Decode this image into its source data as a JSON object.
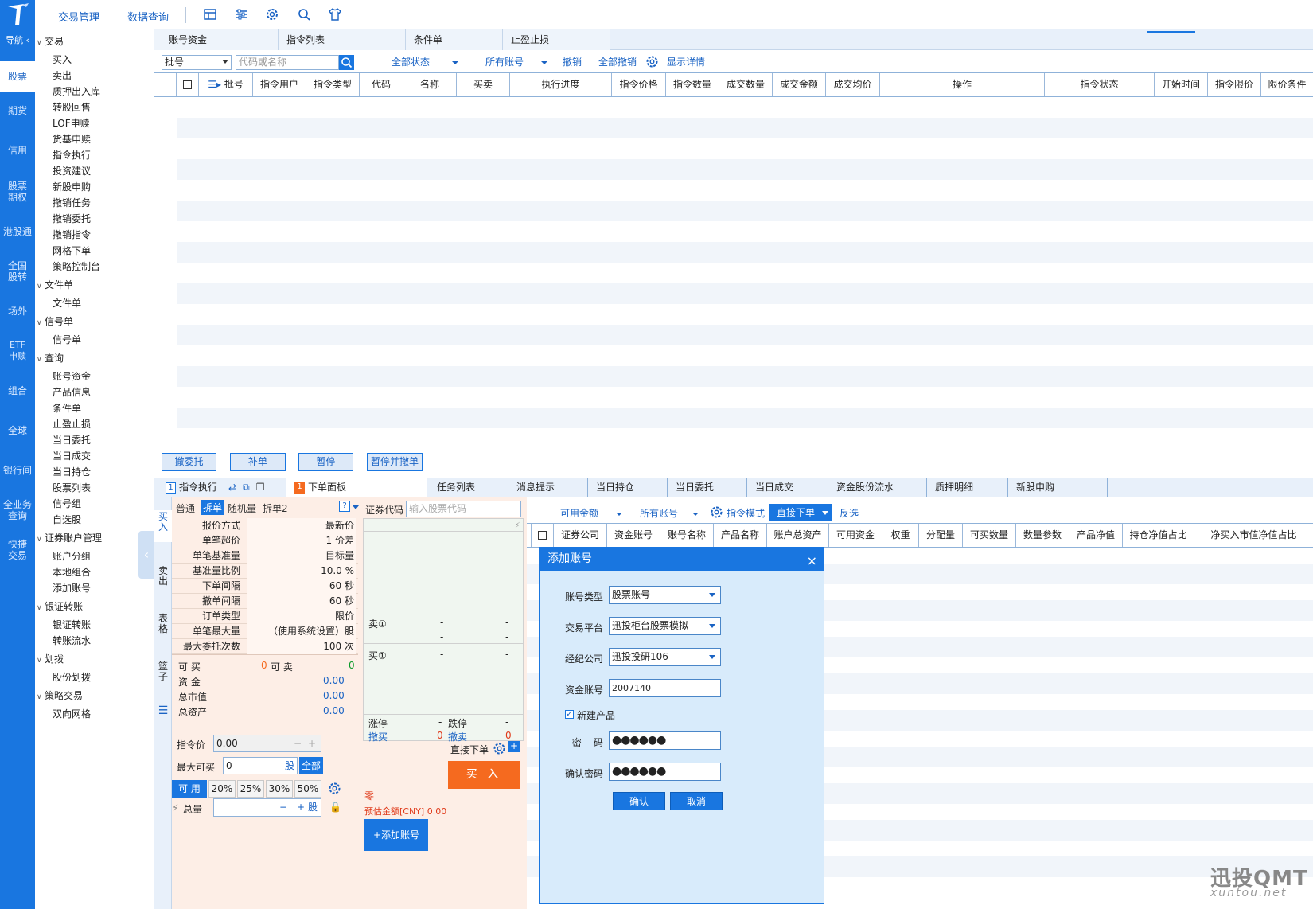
{
  "topbar": {
    "menu1": "交易管理",
    "menu2": "数据查询"
  },
  "nav": {
    "header": "导航",
    "items": [
      "股票",
      "期货",
      "信用",
      "股票期权",
      "港股通",
      "全国股转",
      "场外",
      "ETF申赎",
      "组合",
      "全球",
      "银行间",
      "全业务查询",
      "快捷交易"
    ]
  },
  "tree": {
    "g1": "交易",
    "g1_items": [
      "买入",
      "卖出",
      "质押出入库",
      "转股回售",
      "LOF申赎",
      "货基申赎",
      "指令执行",
      "投资建议",
      "新股申购",
      "撤销任务",
      "撤销委托",
      "撤销指令",
      "网格下单",
      "策略控制台"
    ],
    "g2": "文件单",
    "g2_items": [
      "文件单"
    ],
    "g3": "信号单",
    "g3_items": [
      "信号单"
    ],
    "g4": "查询",
    "g4_items": [
      "账号资金",
      "产品信息",
      "条件单",
      "止盈止损",
      "当日委托",
      "当日成交",
      "当日持仓",
      "股票列表",
      "信号组",
      "自选股"
    ],
    "g5": "证券账户管理",
    "g5_items": [
      "账户分组",
      "本地组合",
      "添加账号"
    ],
    "g6": "银证转账",
    "g6_items": [
      "银证转账",
      "转账流水"
    ],
    "g7": "划拨",
    "g7_items": [
      "股份划拨"
    ],
    "g8": "策略交易",
    "g8_items": [
      "双向网格"
    ]
  },
  "tabs_top": [
    "账号资金",
    "指令列表",
    "条件单",
    "止盈止损"
  ],
  "filter_top": {
    "batch_select": "批号",
    "search_placeholder": "代码或名称",
    "status": "全部状态",
    "account": "所有账号",
    "cancel": "撤销",
    "cancel_all": "全部撤销",
    "show_detail": "显示详情"
  },
  "grid_top": {
    "headers": [
      "批号",
      "指令用户",
      "指令类型",
      "代码",
      "名称",
      "买卖",
      "执行进度",
      "指令价格",
      "指令数量",
      "成交数量",
      "成交金额",
      "成交均价",
      "操作",
      "指令状态",
      "开始时间",
      "指令限价",
      "限价条件"
    ]
  },
  "action_buttons": [
    "撤委托",
    "补单",
    "暂停",
    "暂停并撤单"
  ],
  "tabs_bottom": {
    "t1_num": "1",
    "t1": "指令执行",
    "t2_num": "1",
    "t2": "下单面板",
    "others": [
      "任务列表",
      "消息提示",
      "当日持仓",
      "当日委托",
      "当日成交",
      "资金股份流水",
      "质押明细",
      "新股申购"
    ]
  },
  "vtabs": [
    "买入",
    "卖出",
    "表格",
    "篮子"
  ],
  "order": {
    "mode_tabs": [
      "普通",
      "拆单",
      "随机量",
      "拆单2"
    ],
    "help": "?",
    "params": [
      [
        "报价方式",
        "最新价"
      ],
      [
        "单笔超价",
        "1 价差"
      ],
      [
        "单笔基准量",
        "目标量"
      ],
      [
        "基准量比例",
        "10.0 %"
      ],
      [
        "下单间隔",
        "60 秒"
      ],
      [
        "撤单间隔",
        "60 秒"
      ],
      [
        "订单类型",
        "限价"
      ],
      [
        "单笔最大量",
        "（使用系统设置）股"
      ],
      [
        "最大委托次数",
        "100 次"
      ]
    ],
    "code_label": "证券代码",
    "code_placeholder": "输入股票代码",
    "sell1": "卖①",
    "buy1": "买①",
    "dash": "-",
    "limit_up": "涨停",
    "limit_down": "跌停",
    "cancel_buy": "撤买",
    "cancel_sell": "撤卖",
    "zero": "0",
    "can_buy_label": "可  买",
    "can_buy": "0",
    "can_sell_label": "可  卖",
    "can_sell": "0",
    "funds_label": "资  金",
    "funds": "0.00",
    "mktval_label": "总市值",
    "mktval": "0.00",
    "assets_label": "总资产",
    "assets": "0.00",
    "price_label": "指令价",
    "price": "0.00",
    "maxbuy_label": "最大可买",
    "maxbuy": "0",
    "unit": "股",
    "all": "全部",
    "avail": "可  用",
    "pcts": [
      "20%",
      "25%",
      "30%",
      "50%"
    ],
    "total_label": "总量",
    "direct": "直接下单",
    "buy_btn": "买 入",
    "zero_word": "零",
    "est_label": "预估金额[CNY]",
    "est_value": "0.00",
    "add_account": "+添加账号"
  },
  "right_filter": {
    "avail": "可用金额",
    "account": "所有账号",
    "mode": "指令模式",
    "direct": "直接下单",
    "invert": "反选"
  },
  "grid_right": {
    "headers": [
      "证券公司",
      "资金账号",
      "账号名称",
      "产品名称",
      "账户总资产",
      "可用资金",
      "权重",
      "分配量",
      "可买数量",
      "数量参数",
      "产品净值",
      "持仓净值占比",
      "净买入市值净值占比"
    ]
  },
  "dialog": {
    "title": "添加账号",
    "close": "×",
    "type_label": "账号类型",
    "type": "股票账号",
    "platform_label": "交易平台",
    "platform": "迅投柜台股票模拟",
    "broker_label": "经纪公司",
    "broker": "迅投投研106",
    "fund_label": "资金账号",
    "fund": "2007140",
    "newprod": "新建产品",
    "pwd_label": "密    码",
    "pwd": "●●●●●●",
    "cpwd_label": "确认密码",
    "cpwd": "●●●●●●",
    "ok": "确认",
    "cancel": "取消"
  },
  "watermark": {
    "line1": "迅投QMT",
    "line2": "xuntou.net"
  },
  "colors": {
    "accent": "#1976e0",
    "buy": "#f56a1f"
  }
}
